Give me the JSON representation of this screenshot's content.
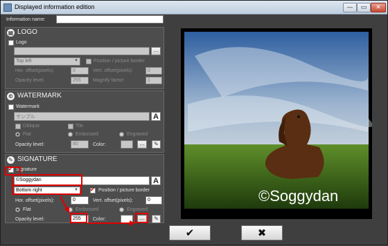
{
  "window": {
    "title": "Displayed information edition",
    "min_glyph": "—",
    "max_glyph": "▭",
    "close_glyph": "✕"
  },
  "info_name": {
    "label": "Information name:",
    "value": ""
  },
  "logo": {
    "icon_glyph": "▦",
    "section_title": "LOGO",
    "checkbox_label": "Logo",
    "path_value": "",
    "browse_label": "...",
    "position_value": "Top left",
    "position_border_label": "Position / picture border",
    "hor_offset_label": "Hor. offset(pixels):",
    "hor_offset_value": "0",
    "vert_offset_label": "Vert. offset(pixels):",
    "vert_offset_value": "0",
    "opacity_label": "Opacity level:",
    "opacity_value": "255",
    "magnify_label": "Magnify factor:",
    "magnify_value": "1"
  },
  "watermark": {
    "icon_glyph": "©",
    "section_title": "WATERMARK",
    "checkbox_label": "Watermark",
    "text_value": "サンプル",
    "font_label": "A",
    "oblique_label": "Oblique",
    "tile_label": "Tile",
    "flat_label": "Flat",
    "embossed_label": "Embossed",
    "engraved_label": "Engraved",
    "opacity_label": "Opacity level:",
    "opacity_value": "80",
    "color_label": "Color:",
    "color_swatch": "#c8c8c8",
    "color_btn_label": "...",
    "picker_glyph": "✎"
  },
  "signature": {
    "icon_glyph": "✎",
    "section_title": "SIGNATURE",
    "checkbox_label": "Signature",
    "text_value": "©Soggydan",
    "font_label": "A",
    "position_value": "Bottom right",
    "position_border_label": "Position / picture border",
    "hor_offset_label": "Hor. offset(pixels):",
    "hor_offset_value": "0",
    "vert_offset_label": "Vert. offset(pixels):",
    "vert_offset_value": "0",
    "flat_label": "Flat",
    "embossed_label": "Embossed",
    "engraved_label": "Engraved",
    "opacity_label": "Opacity level:",
    "opacity_value": "255",
    "color_label": "Color:",
    "color_swatch": "#ffffff",
    "color_btn_label": "...",
    "picker_glyph": "✎"
  },
  "preview": {
    "signature_text": "©Soggydan"
  },
  "footer": {
    "ok_label": "✔",
    "cancel_label": "✖"
  },
  "colors": {
    "highlight": "#e00000",
    "panel_bg": "#4d4d4d",
    "window_bg": "#3f3f3f"
  }
}
